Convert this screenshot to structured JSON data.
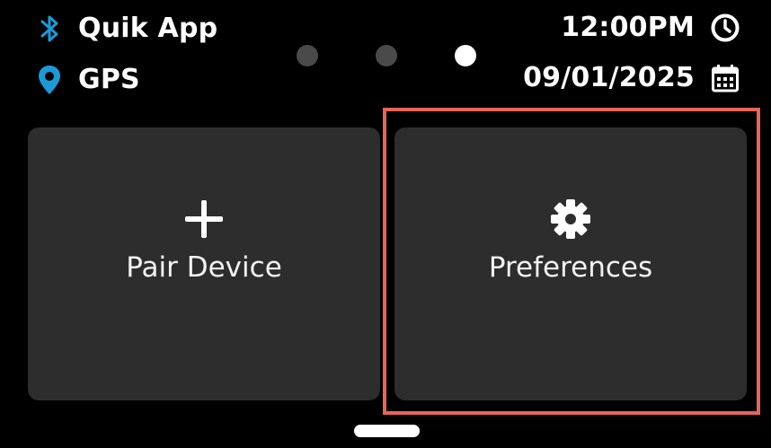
{
  "status": {
    "bluetooth": {
      "label": "Quik App",
      "icon": "bluetooth-icon"
    },
    "gps": {
      "label": "GPS",
      "icon": "location-pin-icon"
    },
    "time": {
      "label": "12:00PM",
      "icon": "clock-icon"
    },
    "date": {
      "label": "09/01/2025",
      "icon": "calendar-icon"
    }
  },
  "pager": {
    "count": 3,
    "active_index": 2
  },
  "tiles": [
    {
      "label": "Pair Device",
      "icon": "plus-icon"
    },
    {
      "label": "Preferences",
      "icon": "gear-icon"
    }
  ],
  "colors": {
    "background": "#000000",
    "tile": "#2d2d2d",
    "accent_blue": "#1a9bd7",
    "highlight": "#e8645a",
    "dot_inactive": "#4a4a4a",
    "dot_active": "#ffffff"
  }
}
